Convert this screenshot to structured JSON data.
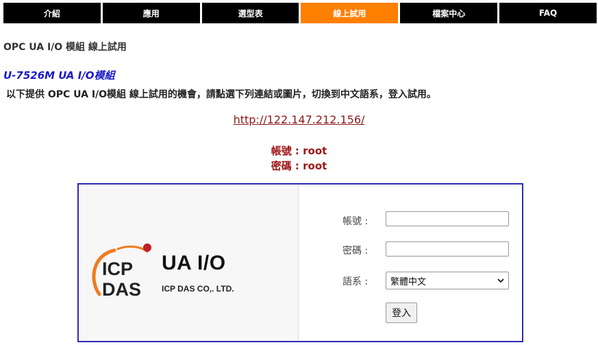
{
  "nav": {
    "tabs": [
      {
        "label": "介紹",
        "active": false
      },
      {
        "label": "應用",
        "active": false
      },
      {
        "label": "選型表",
        "active": false
      },
      {
        "label": "線上試用",
        "active": true
      },
      {
        "label": "檔案中心",
        "active": false
      },
      {
        "label": "FAQ",
        "active": false
      }
    ],
    "active_color": "#ff7f00"
  },
  "page_heading": "OPC UA I/O 模組 線上試用",
  "model_title": "U-7526M UA I/O模組",
  "description": "以下提供 OPC UA I/O模組 線上試用的機會，請點選下列連結或圖片，切換到中文語系，登入試用。",
  "trial_link": "http://122.147.212.156/",
  "credentials": {
    "account": "帳號 : root",
    "password": "密碼 : root"
  },
  "login_panel": {
    "logo_text_top": "ICP",
    "logo_text_bottom": "DAS",
    "brand_name": "UA I/O",
    "company": "ICP DAS CO,. LTD.",
    "account_label": "帳號 :",
    "password_label": "密碼 :",
    "language_label": "語系 :",
    "account_value": "",
    "password_value": "",
    "language_selected": "繁體中文",
    "login_button": "登入"
  }
}
